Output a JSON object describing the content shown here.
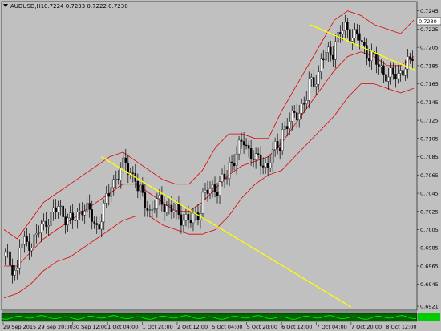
{
  "window": {
    "title": "AUDUSD,H1",
    "ohlc": "0.7224 0.7233 0.7222 0.7230"
  },
  "colors": {
    "background": "#c0c0c0",
    "candles": "#000000",
    "bollinger": "#e00000",
    "trendlines": "#ffff00",
    "price_label_bg": "#ffffff",
    "indicator_bg": "#006400",
    "indicator_line": "#00ff00"
  },
  "chart_data": {
    "type": "candlestick",
    "symbol": "AUDUSD",
    "timeframe": "H1",
    "last_price": "0.7230",
    "y_ticks": [
      "0.7245",
      "0.7225",
      "0.7205",
      "0.7185",
      "0.7165",
      "0.7145",
      "0.7125",
      "0.7105",
      "0.7085",
      "0.7065",
      "0.7045",
      "0.7025",
      "0.7005",
      "0.6985",
      "0.6965",
      "0.6945",
      "0.6921"
    ],
    "x_ticks": [
      "29 Sep 2015",
      "29 Sep 20:00",
      "30 Sep 12:00",
      "1 Oct 04:00",
      "1 Oct 20:00",
      "2 Oct 12:00",
      "5 Oct 04:00",
      "5 Oct 20:00",
      "6 Oct 12:00",
      "7 Oct 04:00",
      "7 Oct 20:00",
      "8 Oct 12:00"
    ],
    "ylim": [
      0.6921,
      0.725
    ],
    "price_path": [
      [
        0.6975,
        0.6945
      ],
      [
        0.6985,
        0.6995
      ],
      [
        0.699,
        0.701
      ],
      [
        0.7015,
        0.7025
      ],
      [
        0.703,
        0.7015
      ],
      [
        0.701,
        0.7035
      ],
      [
        0.703,
        0.701
      ],
      [
        0.7005,
        0.7045
      ],
      [
        0.7055,
        0.707
      ],
      [
        0.708,
        0.7065
      ],
      [
        0.705,
        0.703
      ],
      [
        0.7025,
        0.704
      ],
      [
        0.7035,
        0.702
      ],
      [
        0.7025,
        0.7015
      ],
      [
        0.701,
        0.703
      ],
      [
        0.704,
        0.7055
      ],
      [
        0.705,
        0.706
      ],
      [
        0.7075,
        0.7095
      ],
      [
        0.7105,
        0.7085
      ],
      [
        0.708,
        0.7075
      ],
      [
        0.708,
        0.7095
      ],
      [
        0.7115,
        0.7125
      ],
      [
        0.713,
        0.7145
      ],
      [
        0.716,
        0.7175
      ],
      [
        0.719,
        0.72
      ],
      [
        0.721,
        0.723
      ],
      [
        0.7225,
        0.7215
      ],
      [
        0.721,
        0.7195
      ],
      [
        0.719,
        0.718
      ],
      [
        0.717,
        0.7175
      ],
      [
        0.718,
        0.7185
      ],
      [
        0.7195,
        0.723
      ]
    ],
    "bollinger": {
      "upper": [
        0.7005,
        0.6995,
        0.7015,
        0.7035,
        0.7045,
        0.7055,
        0.7065,
        0.7075,
        0.7085,
        0.709,
        0.708,
        0.707,
        0.706,
        0.7055,
        0.7055,
        0.707,
        0.7095,
        0.711,
        0.711,
        0.7105,
        0.7105,
        0.7135,
        0.716,
        0.7185,
        0.721,
        0.7235,
        0.7245,
        0.724,
        0.723,
        0.7225,
        0.722,
        0.7235
      ],
      "middle": [
        0.6965,
        0.6965,
        0.698,
        0.6995,
        0.7005,
        0.7015,
        0.7025,
        0.7035,
        0.7045,
        0.7055,
        0.7055,
        0.7045,
        0.7035,
        0.7025,
        0.7025,
        0.7035,
        0.705,
        0.7065,
        0.7075,
        0.708,
        0.7085,
        0.71,
        0.712,
        0.714,
        0.716,
        0.718,
        0.7195,
        0.72,
        0.7195,
        0.7185,
        0.7185,
        0.7195
      ],
      "lower": [
        0.693,
        0.6935,
        0.6945,
        0.696,
        0.697,
        0.6975,
        0.6985,
        0.6995,
        0.7005,
        0.7015,
        0.702,
        0.702,
        0.701,
        0.7005,
        0.7,
        0.7,
        0.7005,
        0.702,
        0.704,
        0.7055,
        0.7065,
        0.707,
        0.7085,
        0.71,
        0.7115,
        0.713,
        0.715,
        0.7165,
        0.7165,
        0.716,
        0.7155,
        0.716
      ]
    },
    "trendlines": [
      {
        "from": [
          "1 Oct 04:00",
          0.7085
        ],
        "to": [
          "7 Oct 20:00",
          0.692
        ]
      },
      {
        "from": [
          "7 Oct 04:00",
          0.723
        ],
        "to": [
          "8 Oct 20:00",
          0.718
        ]
      }
    ],
    "grid": false,
    "legend": "none"
  }
}
